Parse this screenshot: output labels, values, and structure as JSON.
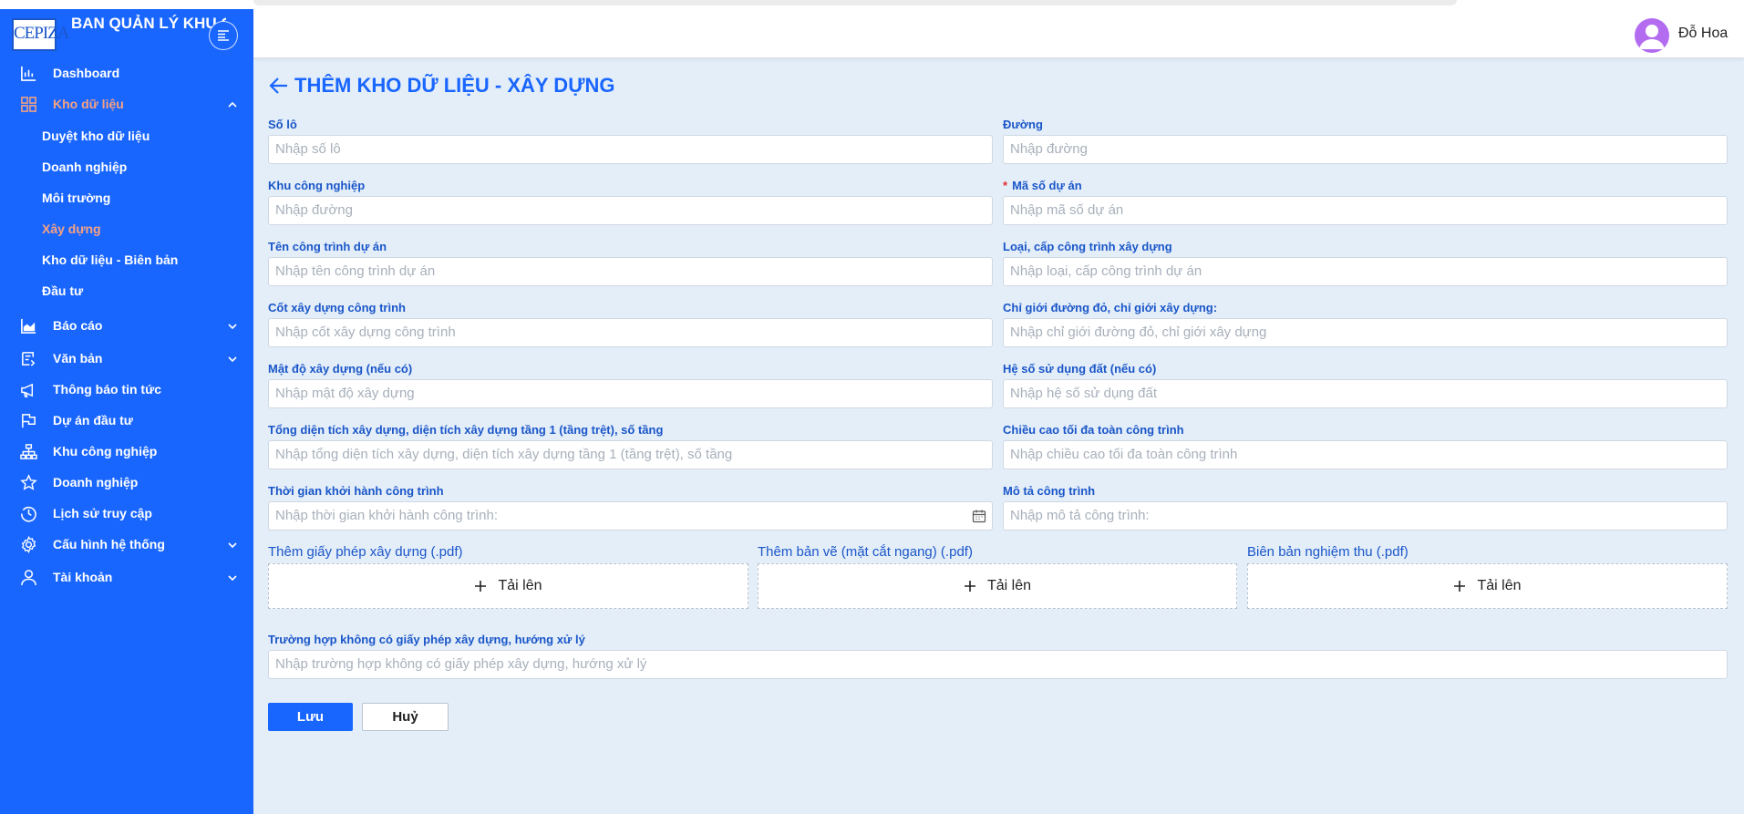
{
  "app": {
    "logo_text": "CEPIZA",
    "title": "BAN QUẢN LÝ KHU CHẾ XUẤT KHU CN"
  },
  "header": {
    "user_name": "Đỗ Hoa"
  },
  "sidebar": {
    "items": [
      {
        "label": "Dashboard",
        "icon": "bar-chart-icon"
      },
      {
        "label": "Kho dữ liệu",
        "icon": "grid-icon",
        "expanded": true
      },
      {
        "label": "Báo cáo",
        "icon": "area-chart-icon"
      },
      {
        "label": "Văn bản",
        "icon": "document-icon"
      },
      {
        "label": "Thông báo tin tức",
        "icon": "megaphone-icon"
      },
      {
        "label": "Dự án đầu tư",
        "icon": "flag-icon"
      },
      {
        "label": "Khu công nghiệp",
        "icon": "cluster-icon"
      },
      {
        "label": "Doanh nghiệp",
        "icon": "star-icon"
      },
      {
        "label": "Lịch sử truy cập",
        "icon": "history-icon"
      },
      {
        "label": "Cấu hình hệ thống",
        "icon": "gear-icon"
      },
      {
        "label": "Tài khoản",
        "icon": "user-icon"
      }
    ],
    "sub_items": [
      "Duyệt kho dữ liệu",
      "Doanh nghiệp",
      "Môi trường",
      "Xây dựng",
      "Kho dữ liệu - Biên bản",
      "Đầu tư"
    ],
    "active_sub": "Xây dựng",
    "accent_color": "#f5a282",
    "bg_color": "#1966ff"
  },
  "page": {
    "title": "THÊM KHO DỮ LIỆU - XÂY DỰNG"
  },
  "form": {
    "so_lo": {
      "label": "Số lô",
      "placeholder": "Nhập số lô"
    },
    "duong": {
      "label": "Đường",
      "placeholder": "Nhập đường"
    },
    "khu_cn": {
      "label": "Khu công nghiệp",
      "placeholder": "Nhập đường"
    },
    "ma_so": {
      "label": "Mã số dự án",
      "required": "*",
      "placeholder": "Nhập mã số dự án"
    },
    "ten_cong_trinh": {
      "label": "Tên công trình dự án",
      "placeholder": "Nhập tên công trình dự án"
    },
    "loai_cap": {
      "label": "Loại, cấp công trình xây dựng",
      "placeholder": "Nhập loại, cấp công trình dự án"
    },
    "cot_xd": {
      "label": "Cốt xây dựng công trình",
      "placeholder": "Nhập cốt xây dựng công trình"
    },
    "chi_gioi": {
      "label": "Chỉ giới đường đỏ, chỉ giới xây dựng:",
      "placeholder": "Nhập chỉ giới đường đỏ, chỉ giới xây dựng"
    },
    "mat_do": {
      "label": "Mật độ xây dựng (nếu có)",
      "placeholder": "Nhập mật độ xây dựng"
    },
    "he_so": {
      "label": "Hệ số sử dụng đất (nếu có)",
      "placeholder": "Nhập hệ số sử dụng đất"
    },
    "tong_dt": {
      "label": "Tổng diện tích xây dựng, diện tích xây dựng tầng 1 (tầng trệt), số tầng",
      "placeholder": "Nhập tổng diện tích xây dựng, diện tích xây dựng tầng 1 (tầng trệt), số tầng"
    },
    "chieu_cao": {
      "label": "Chiều cao tối đa toàn công trình",
      "placeholder": "Nhập chiều cao tối đa toàn công trình"
    },
    "thoi_gian": {
      "label": "Thời gian khởi hành công trình",
      "placeholder": "Nhập thời gian khởi hành công trình:"
    },
    "mo_ta": {
      "label": "Mô tả công trình",
      "placeholder": "Nhập mô tả công trình:"
    },
    "uploads": [
      {
        "label": "Thêm giấy phép xây dựng (.pdf)",
        "button": "Tải lên"
      },
      {
        "label": "Thêm bản vẽ (mặt cắt ngang) (.pdf)",
        "button": "Tải lên"
      },
      {
        "label": "Biên bản nghiệm thu (.pdf)",
        "button": "Tải lên"
      }
    ],
    "truong_hop": {
      "label": "Trường hợp không có giấy phép xây dựng, hướng xử lý",
      "placeholder": "Nhập trường hợp không có giấy phép xây dựng, hướng xử lý"
    }
  },
  "actions": {
    "save": "Lưu",
    "cancel": "Huỷ"
  }
}
